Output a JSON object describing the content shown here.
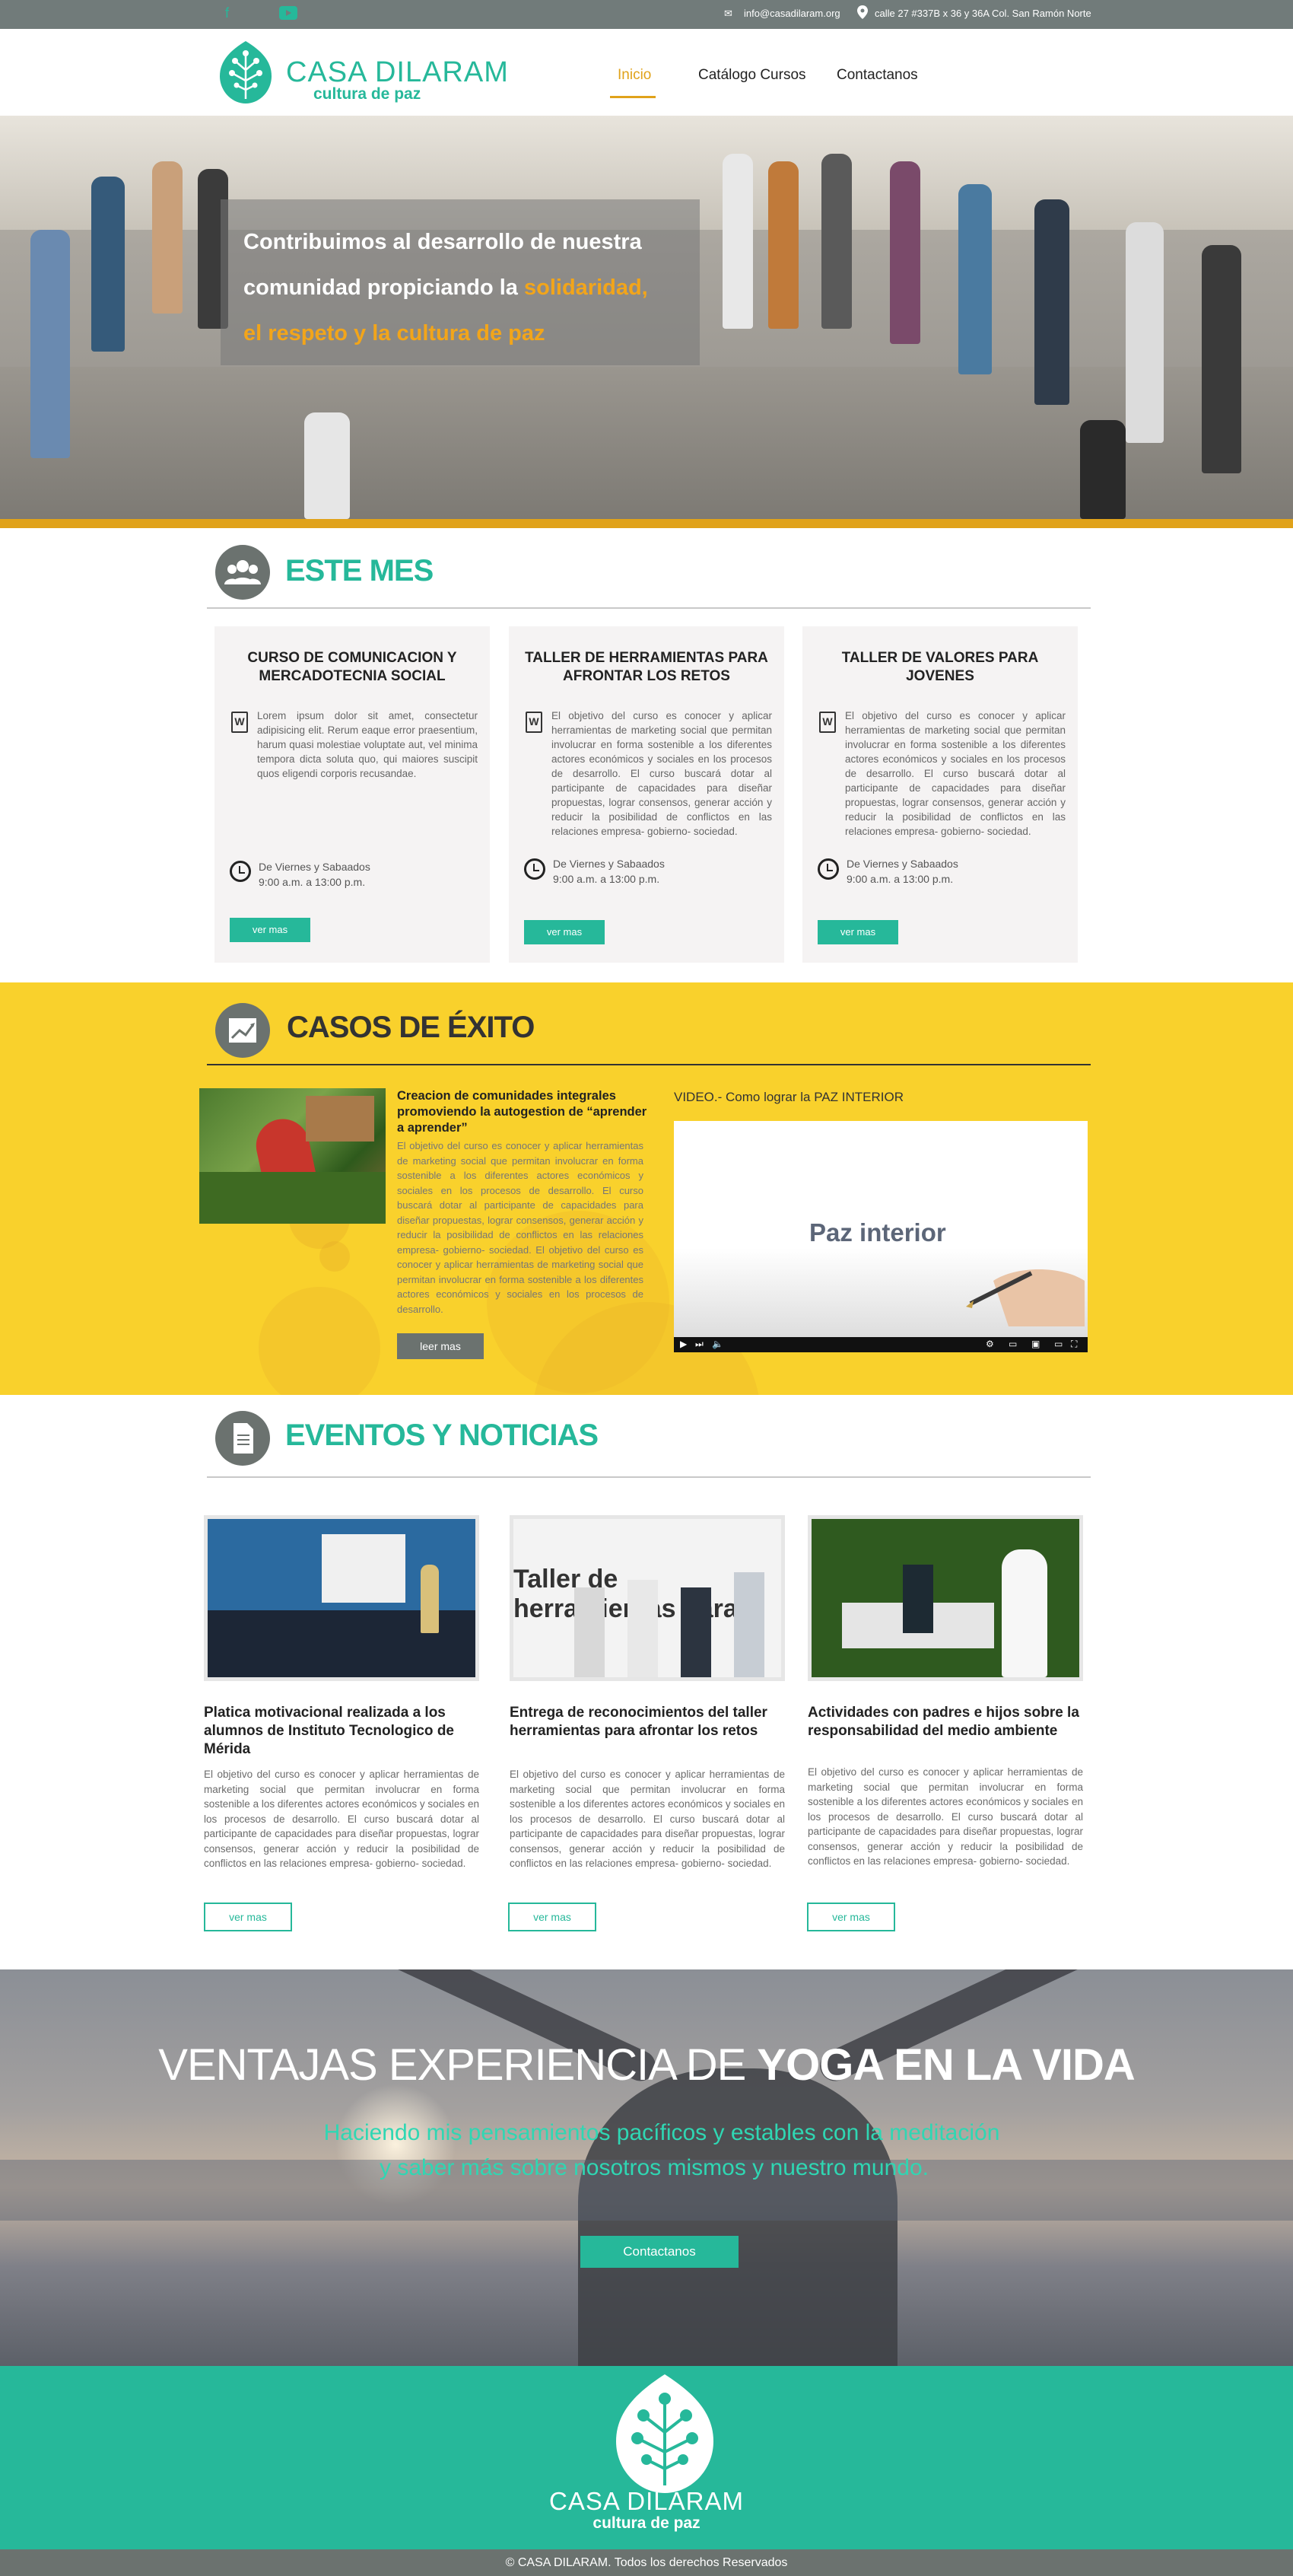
{
  "topbar": {
    "email": "info@casadilaram.org",
    "address": "calle 27 #337B  x 36 y 36A Col. San Ramón Norte"
  },
  "brand": {
    "name": "CASA DILARAM",
    "tagline": "cultura de paz",
    "accent": "#26b89a",
    "highlight": "#e0a21a"
  },
  "nav": {
    "items": [
      "Inicio",
      "Catálogo Cursos",
      "Contactanos"
    ],
    "active": "Inicio"
  },
  "hero": {
    "line1": "Contribuimos al desarrollo de nuestra",
    "line2_prefix": "comunidad propiciando la ",
    "line2_highlight": "solidaridad,",
    "line3": "el respeto y la cultura de paz"
  },
  "este_mes": {
    "title": "ESTE MES",
    "cards": [
      {
        "title": "CURSO DE COMUNICACION Y MERCADOTECNIA SOCIAL",
        "text": "Lorem ipsum dolor sit amet, consectetur adipisicing elit. Rerum eaque error praesentium, harum quasi molestiae voluptate aut, vel minima tempora dicta soluta quo, qui maiores suscipit quos eligendi corporis recusandae.",
        "schedule_days": "De Viernes y Sabaados",
        "schedule_hours": "9:00 a.m.  a  13:00 p.m.",
        "button": "ver mas"
      },
      {
        "title": "TALLER DE HERRAMIENTAS PARA AFRONTAR LOS RETOS",
        "text": "El objetivo del curso es conocer y aplicar herramientas de marketing social que permitan involucrar en forma sostenible a los diferentes actores económicos y sociales en los procesos de desarrollo. El curso buscará dotar al participante de capacidades para diseñar propuestas, lograr consensos, generar acción y reducir la posibilidad de conflictos en las relaciones empresa- gobierno- sociedad.",
        "schedule_days": "De Viernes y Sabaados",
        "schedule_hours": "9:00 a.m.  a  13:00 p.m.",
        "button": "ver mas"
      },
      {
        "title": "TALLER DE VALORES PARA JOVENES",
        "text": "El objetivo del curso es conocer y aplicar herramientas de marketing social que permitan involucrar en forma sostenible a los diferentes actores económicos y sociales en los procesos de desarrollo. El curso buscará dotar al participante de capacidades para diseñar propuestas, lograr consensos, generar acción y reducir la posibilidad de conflictos en las relaciones empresa- gobierno- sociedad.",
        "schedule_days": "De Viernes y Sabaados",
        "schedule_hours": "9:00 a.m.  a  13:00 p.m.",
        "button": "ver mas"
      }
    ]
  },
  "casos": {
    "title": "CASOS DE ÉXITO",
    "case_title": "Creacion de comunidades integrales promoviendo la autogestion de “aprender a aprender”",
    "case_text": "El objetivo del curso es conocer y aplicar herramientas de marketing social que permitan involucrar en forma sostenible a los diferentes actores económicos y sociales en los procesos de desarrollo. El curso buscará dotar al participante de capacidades para diseñar propuestas, lograr consensos, generar acción y reducir la posibilidad de conflictos en las relaciones empresa- gobierno- sociedad. El objetivo del curso es conocer y aplicar herramientas de marketing social que permitan involucrar en forma sostenible a los diferentes actores económicos y sociales en los procesos de desarrollo.",
    "button": "leer mas",
    "video_label": "VIDEO.- Como lograr la PAZ INTERIOR",
    "video_title": "Paz interior"
  },
  "eventos": {
    "title": "EVENTOS Y NOTICIAS",
    "items": [
      {
        "title": "Platica motivacional realizada a los alumnos de Instituto Tecnologico de Mérida",
        "text": "El objetivo del curso es conocer y aplicar herramientas de marketing social que permitan involucrar en forma sostenible a los diferentes actores económicos y sociales en los procesos de desarrollo. El curso buscará dotar al participante de capacidades para diseñar propuestas, lograr consensos, generar acción y reducir la posibilidad de conflictos en las relaciones empresa- gobierno- sociedad.",
        "button": "ver mas"
      },
      {
        "title": "Entrega de reconocimientos del taller herramientas para afrontar los retos",
        "text": "El objetivo del curso es conocer y aplicar herramientas de marketing social que permitan involucrar en forma sostenible a los diferentes actores económicos y sociales en los procesos de desarrollo. El curso buscará dotar al participante de capacidades para diseñar propuestas, lograr consensos, generar acción y reducir la posibilidad de conflictos en las relaciones empresa- gobierno- sociedad.",
        "button": "ver mas"
      },
      {
        "title": "Actividades con padres e hijos sobre la responsabilidad del medio ambiente",
        "text": "El objetivo del curso es conocer y aplicar herramientas de marketing social que permitan involucrar en forma sostenible a los diferentes actores económicos y sociales en los procesos de desarrollo. El curso buscará dotar al participante de capacidades para diseñar propuestas, lograr consensos, generar acción y reducir la posibilidad de conflictos en las relaciones empresa- gobierno- sociedad.",
        "button": "ver mas"
      }
    ],
    "slide_text": "Taller de herramientas para"
  },
  "yoga": {
    "title_light": "VENTAJAS EXPERIENCIA DE ",
    "title_bold": "YOGA EN LA VIDA",
    "sub1": "Haciendo mis pensamientos pacíficos y estables con la meditación",
    "sub2": "y saber más sobre nosotros mismos y nuestro mundo.",
    "button": "Contactanos"
  },
  "footer": {
    "copyright": "© CASA DILARAM. Todos los derechos Reservados"
  }
}
